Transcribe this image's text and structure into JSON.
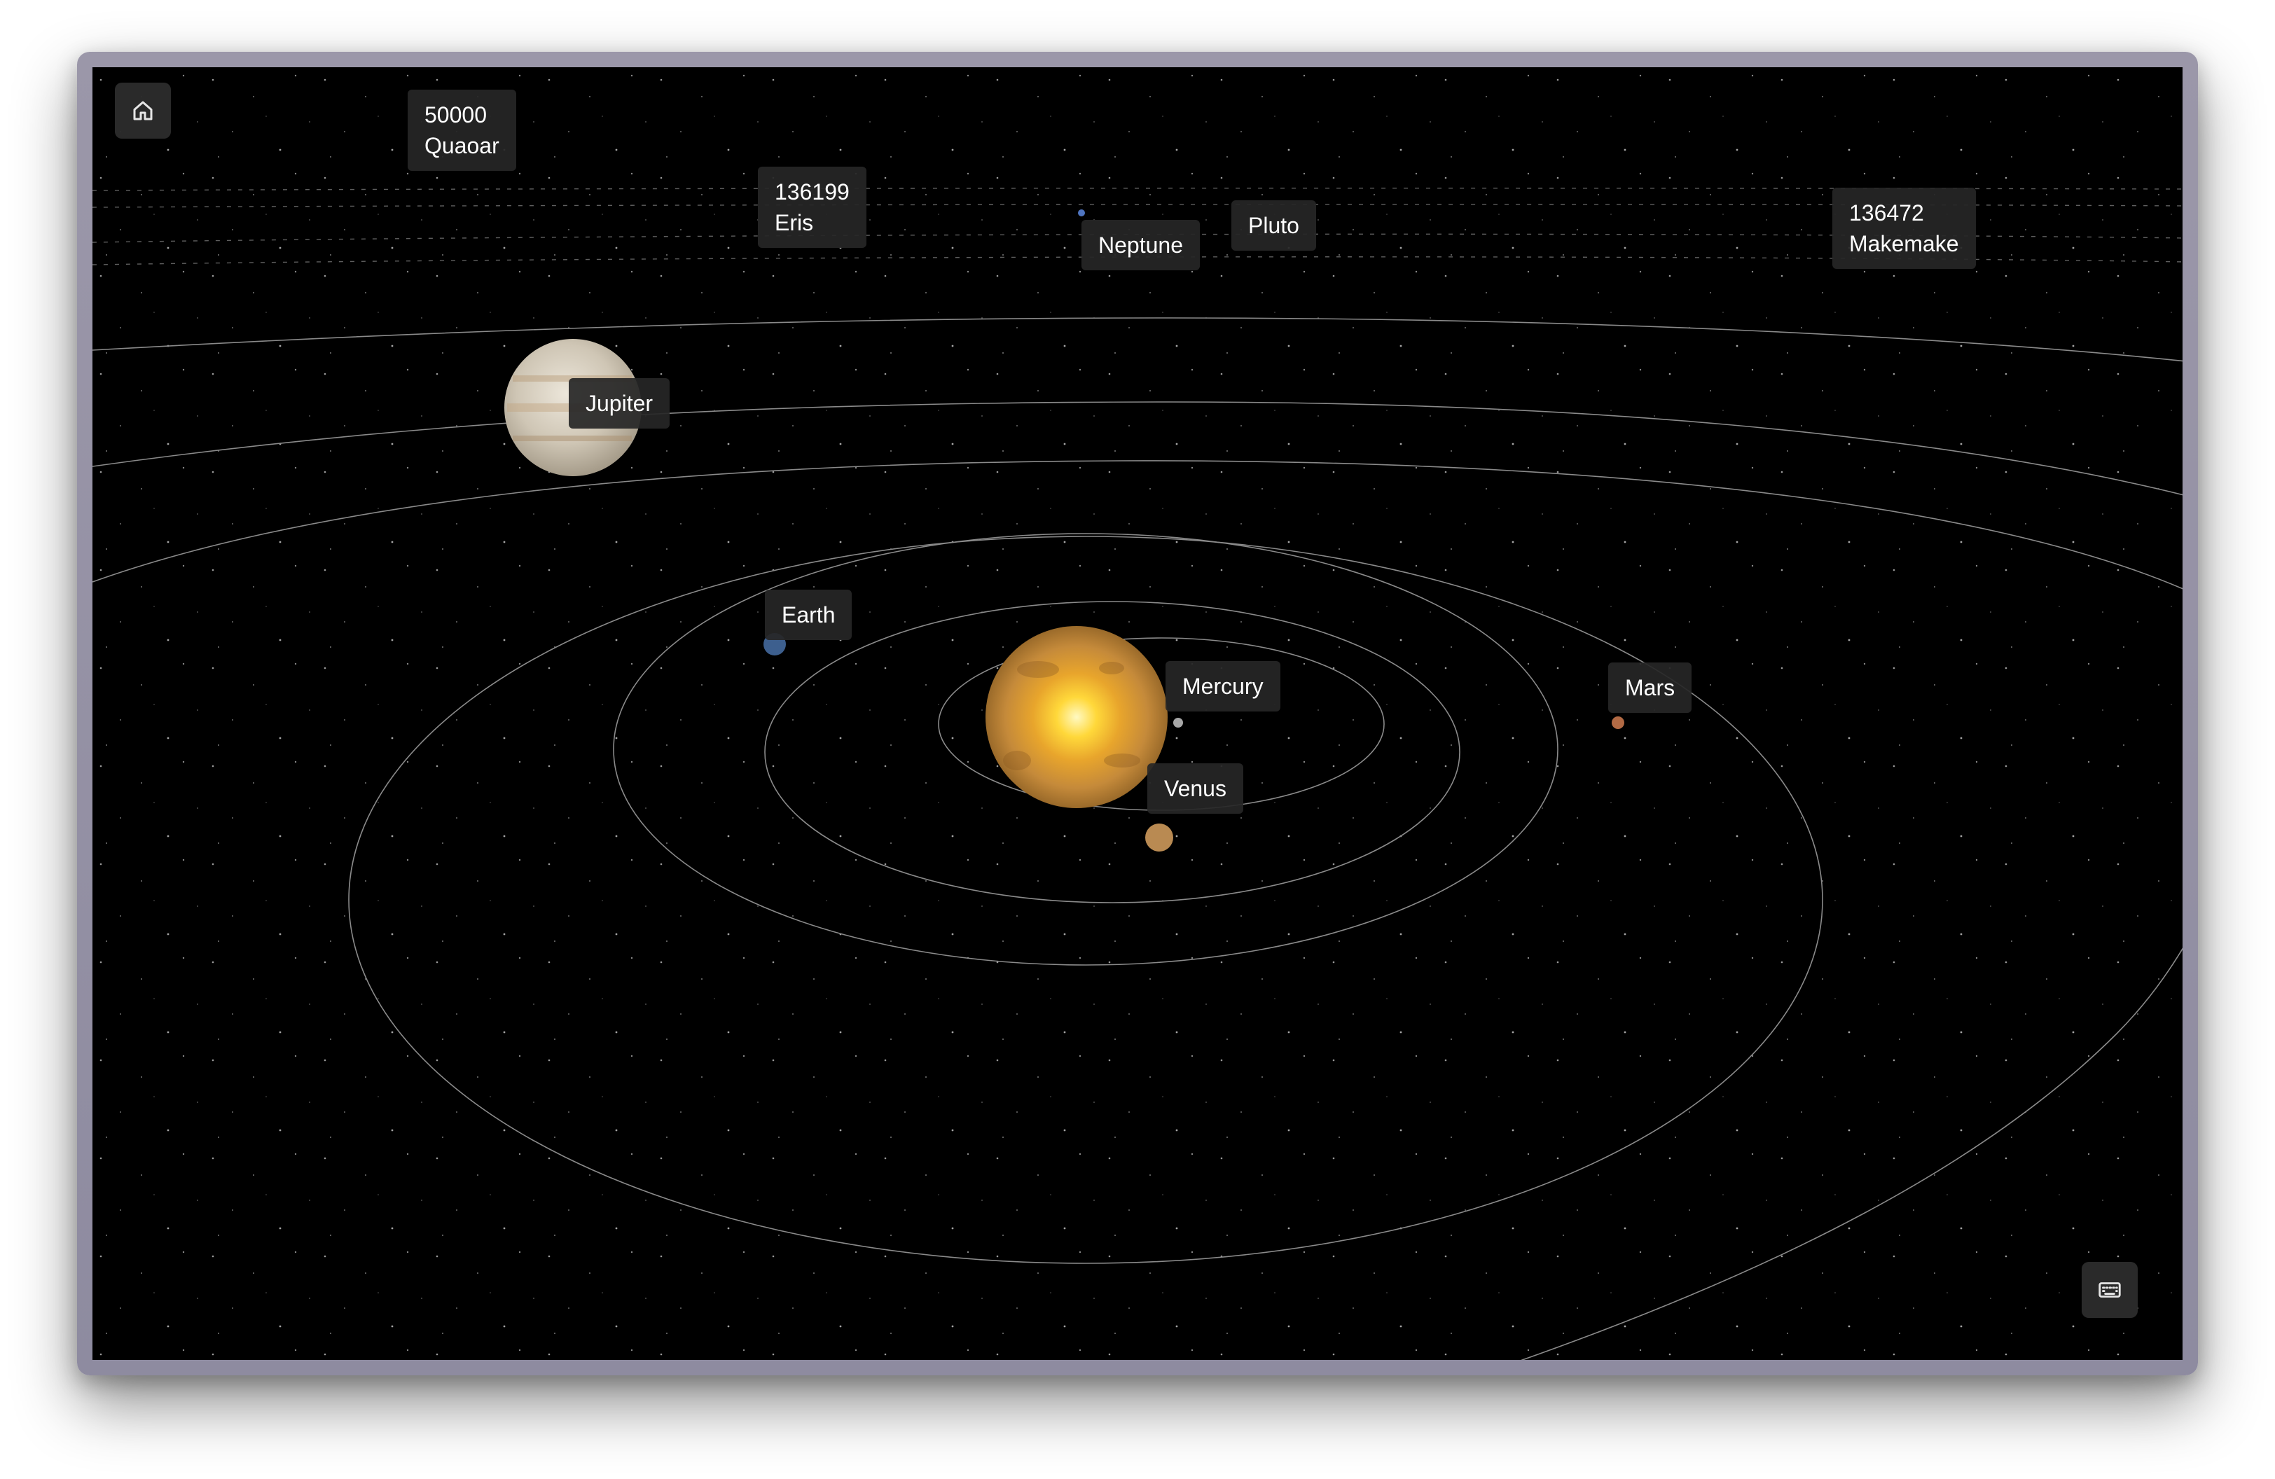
{
  "controls": {
    "home_icon": "home-icon",
    "keyboard_icon": "keyboard-icon"
  },
  "bodies": {
    "sun": "sun",
    "mercury": "Mercury",
    "venus": "Venus",
    "earth": "Earth",
    "mars": "Mars",
    "jupiter": "Jupiter",
    "neptune": "Neptune",
    "pluto": "Pluto",
    "eris": {
      "number": "136199",
      "name": "Eris"
    },
    "quaoar": {
      "number": "50000",
      "name": "Quaoar"
    },
    "makemake": {
      "number": "136472",
      "name": "Makemake"
    }
  },
  "colors": {
    "space": "#000000",
    "orbit": "#8a8a8a",
    "label_bg": "#262626",
    "label_text": "#ffffff"
  }
}
